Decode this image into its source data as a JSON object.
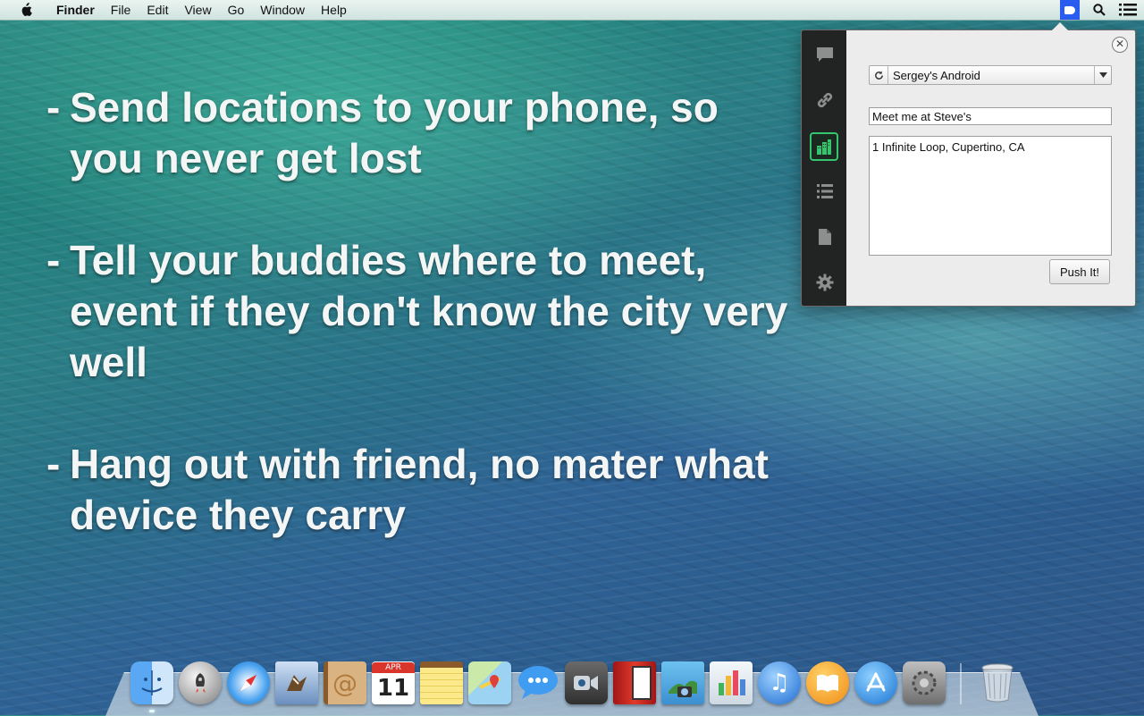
{
  "menubar": {
    "app_name": "Finder",
    "items": [
      "File",
      "Edit",
      "View",
      "Go",
      "Window",
      "Help"
    ]
  },
  "slide": {
    "bullets": [
      {
        "dash": "-",
        "text": "Send locations to your phone, so you never get lost"
      },
      {
        "dash": "-",
        "text": "Tell your buddies where to meet, event if they don't know the city very well"
      },
      {
        "dash": "-",
        "text": "Hang out with friend, no mater what device they carry"
      }
    ]
  },
  "popover": {
    "device": "Sergey's Android",
    "title_value": "Meet me at Steve's",
    "address_value": "1 Infinite Loop, Cupertino, CA",
    "push_label": "Push It!",
    "close_glyph": "✕",
    "sidebar_icons": [
      "note-icon",
      "link-icon",
      "address-icon",
      "list-icon",
      "file-icon",
      "settings-icon"
    ],
    "active_tab": "address-icon",
    "accent_color": "#36c46e"
  },
  "dock": {
    "calendar_month": "APR",
    "calendar_day": "11",
    "apps": [
      "finder",
      "launchpad",
      "safari",
      "mail",
      "contacts",
      "calendar",
      "notes",
      "maps",
      "messages",
      "facetime",
      "photo-booth",
      "iphoto",
      "numbers",
      "itunes",
      "ibooks",
      "app-store",
      "system-preferences",
      "trash"
    ]
  }
}
